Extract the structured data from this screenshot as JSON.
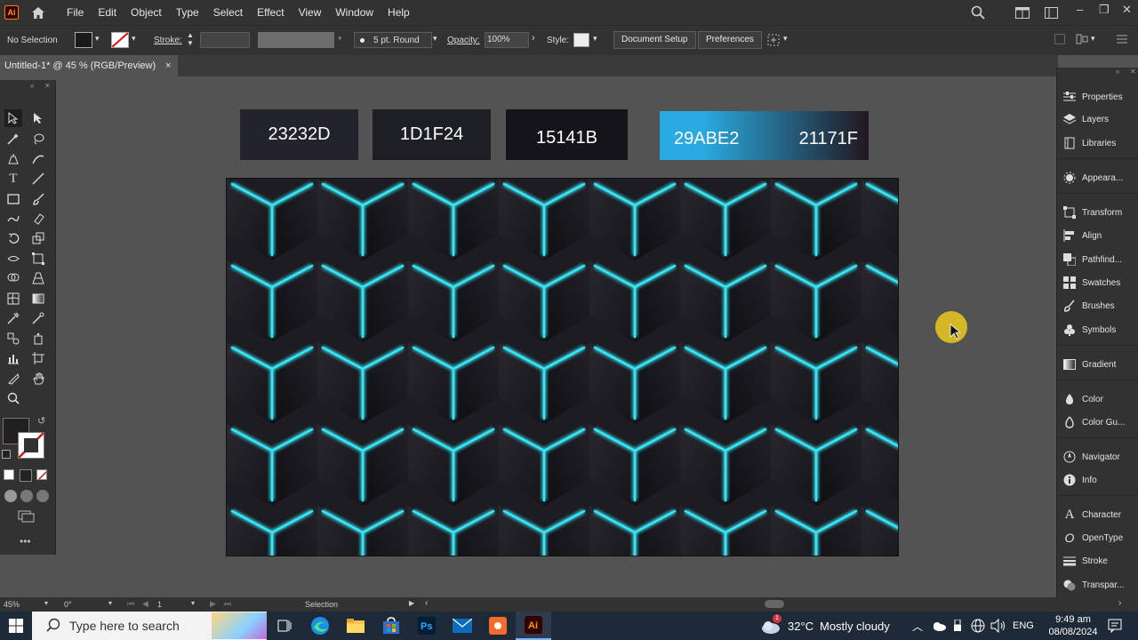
{
  "app": {
    "logo_text": "Ai"
  },
  "menu": [
    "File",
    "Edit",
    "Object",
    "Type",
    "Select",
    "Effect",
    "View",
    "Window",
    "Help"
  ],
  "control_bar": {
    "selection_label": "No Selection",
    "stroke_label": "Stroke:",
    "brush_value": "5 pt. Round",
    "opacity_label": "Opacity:",
    "opacity_value": "100%",
    "style_label": "Style:",
    "document_setup": "Document Setup",
    "preferences": "Preferences"
  },
  "document_tab": {
    "title": "Untitled-1* @ 45 % (RGB/Preview)",
    "close": "×"
  },
  "swatches": [
    {
      "label": "23232D",
      "color": "#23232D"
    },
    {
      "label": "1D1F24",
      "color": "#1D1F24"
    },
    {
      "label": "15141B",
      "color": "#15141B"
    }
  ],
  "gradient_swatch": {
    "start_label": "29ABE2",
    "end_label": "21171F",
    "start_color": "#29ABE2",
    "end_color": "#21171F"
  },
  "right_panels": [
    "Properties",
    "Layers",
    "Libraries",
    "Appeara...",
    "Transform",
    "Align",
    "Pathfind...",
    "Swatches",
    "Brushes",
    "Symbols",
    "Gradient",
    "Color",
    "Color Gu...",
    "Navigator",
    "Info",
    "Character",
    "OpenType",
    "Stroke",
    "Transpar..."
  ],
  "status_bar": {
    "zoom": "45%",
    "rotation": "0°",
    "artboard": "1",
    "tool": "Selection"
  },
  "taskbar": {
    "search_placeholder": "Type here to search",
    "weather_temp": "32°C",
    "weather_text": "Mostly cloudy",
    "language": "ENG",
    "time": "9:49 am",
    "date": "08/08/2024",
    "weather_badge": "1"
  },
  "colors": {
    "ui_dark": "#323232",
    "canvas": "#535353",
    "accent_cyan": "#37e6f5",
    "pattern_bg": "#1d1c22"
  }
}
